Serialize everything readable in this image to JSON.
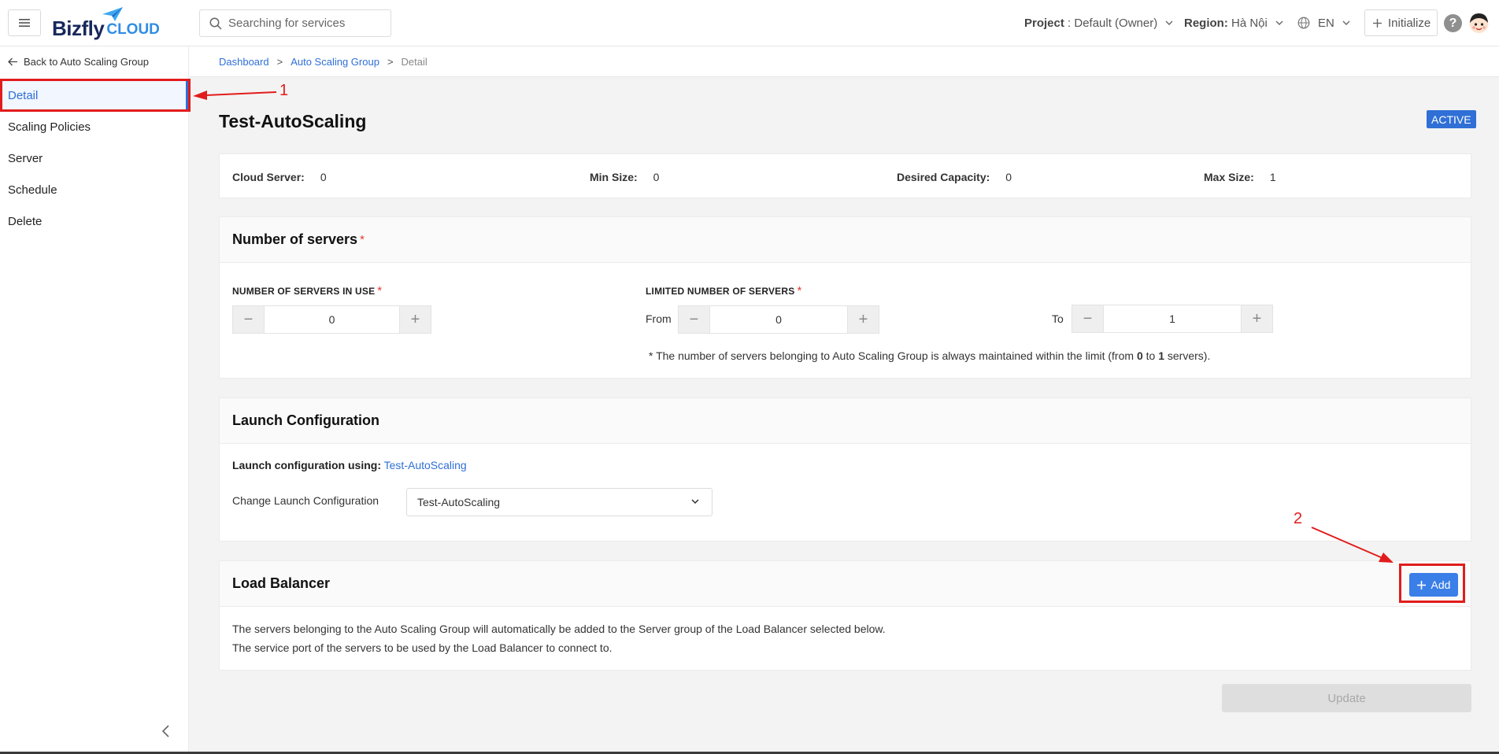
{
  "header": {
    "logo_main": "Bizfly",
    "logo_sub": "CLOUD",
    "search_placeholder": "Searching for services",
    "project_label": "Project",
    "project_value": ": Default (Owner)",
    "region_label": "Region:",
    "region_value": "Hà Nội",
    "language": "EN",
    "initialize_label": "Initialize",
    "help_label": "?"
  },
  "breadcrumb": {
    "items": [
      "Dashboard",
      "Auto Scaling Group"
    ],
    "current": "Detail",
    "separator": ">"
  },
  "sidebar": {
    "back_label": "Back to Auto Scaling Group",
    "items": [
      {
        "label": "Detail",
        "active": true
      },
      {
        "label": "Scaling Policies"
      },
      {
        "label": "Server"
      },
      {
        "label": "Schedule"
      },
      {
        "label": "Delete"
      }
    ]
  },
  "page": {
    "title": "Test-AutoScaling",
    "status": "ACTIVE"
  },
  "stats": {
    "cloud_server_label": "Cloud Server:",
    "cloud_server_value": "0",
    "min_size_label": "Min Size:",
    "min_size_value": "0",
    "desired_label": "Desired Capacity:",
    "desired_value": "0",
    "max_size_label": "Max Size:",
    "max_size_value": "1"
  },
  "servers": {
    "title": "Number of servers",
    "required_mark": "*",
    "in_use_label": "NUMBER OF SERVERS IN USE",
    "in_use_value": "0",
    "limited_label": "LIMITED NUMBER OF SERVERS",
    "from_label": "From",
    "from_value": "0",
    "to_label": "To",
    "to_value": "1",
    "note_prefix": "* The number of servers belonging to Auto Scaling Group is always maintained within the limit (from ",
    "note_from": "0",
    "note_mid": " to ",
    "note_to": "1",
    "note_suffix": " servers)."
  },
  "launch": {
    "title": "Launch Configuration",
    "using_label": "Launch configuration using:",
    "using_value": "Test-AutoScaling",
    "change_label": "Change Launch Configuration",
    "selected": "Test-AutoScaling"
  },
  "load_balancer": {
    "title": "Load Balancer",
    "add_label": "Add",
    "line1": "The servers belonging to the Auto Scaling Group will automatically be added to the Server group of the Load Balancer selected below.",
    "line2": "The service port of the servers to be used by the Load Balancer to connect to."
  },
  "update_label": "Update",
  "annotations": [
    "1",
    "2"
  ],
  "colors": {
    "accent": "#2f6fd6",
    "annotation": "#e21c1c",
    "logo_dark": "#17285c",
    "logo_light": "#2f8de4"
  }
}
